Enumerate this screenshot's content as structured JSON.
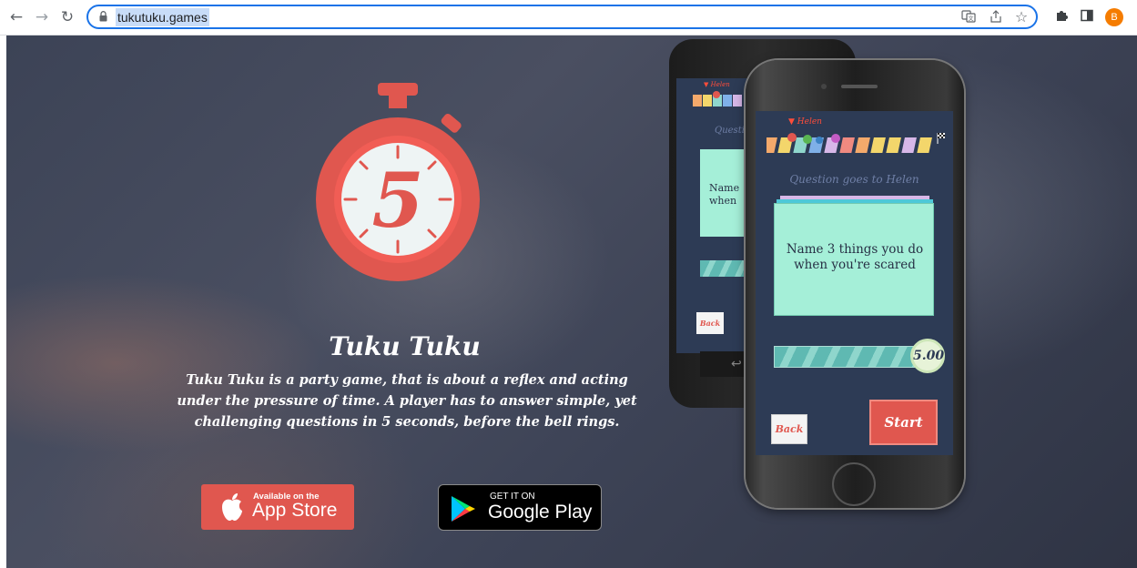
{
  "browser": {
    "url": "tukutuku.games",
    "profile_initial": "B",
    "icons": [
      "back-icon",
      "forward-icon",
      "reload-icon",
      "lock-icon",
      "translate-icon",
      "share-icon",
      "bookmark-star-icon",
      "extensions-icon",
      "side-panel-icon"
    ]
  },
  "hero": {
    "timer_digit": "5",
    "title": "Tuku Tuku",
    "description": "Tuku Tuku is a party game, that is about a reflex and acting under the pressure of time. A player has to answer simple, yet challenging questions in 5 seconds, before the bell rings.",
    "app_store": {
      "small": "Available on the",
      "big": "App Store"
    },
    "google_play": {
      "small": "GET IT ON",
      "big": "Google Play"
    }
  },
  "phone_front": {
    "player_name": "▼ Helen",
    "question_label": "Question goes to Helen",
    "card_text_line1": "Name 3 things you do",
    "card_text_line2": "when you're scared",
    "timer": "5.00",
    "back_label": "Back",
    "start_label": "Start"
  },
  "phone_back": {
    "player_name": "▼ Helen",
    "question_label": "Questi",
    "card_text_line1": "Name",
    "card_text_line2": "when",
    "back_label": "Back"
  },
  "colors": {
    "accent_red": "#e0574f",
    "screen_bg": "#2d3b55",
    "card_mint": "#a5efd8",
    "omnibox_focus": "#1a73e8",
    "avatar": "#f57c00"
  }
}
